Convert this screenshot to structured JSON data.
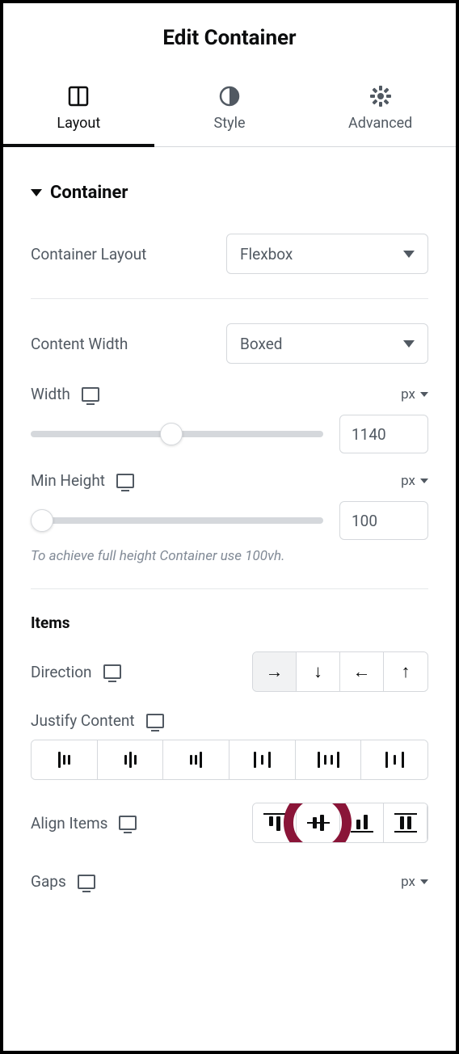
{
  "header": {
    "title": "Edit Container"
  },
  "tabs": {
    "layout": "Layout",
    "style": "Style",
    "advanced": "Advanced",
    "active": "layout"
  },
  "section": {
    "title": "Container",
    "container_layout": {
      "label": "Container Layout",
      "value": "Flexbox"
    },
    "content_width": {
      "label": "Content Width",
      "value": "Boxed"
    },
    "width": {
      "label": "Width",
      "unit": "px",
      "value": "1140",
      "slider_percent": 48
    },
    "min_height": {
      "label": "Min Height",
      "unit": "px",
      "value": "100",
      "slider_percent": 4,
      "hint": "To achieve full height Container use 100vh."
    }
  },
  "items": {
    "heading": "Items",
    "direction": {
      "label": "Direction",
      "active_index": 0
    },
    "justify": {
      "label": "Justify Content"
    },
    "align": {
      "label": "Align Items",
      "highlight_index": 1
    },
    "gaps": {
      "label": "Gaps",
      "unit": "px"
    }
  }
}
